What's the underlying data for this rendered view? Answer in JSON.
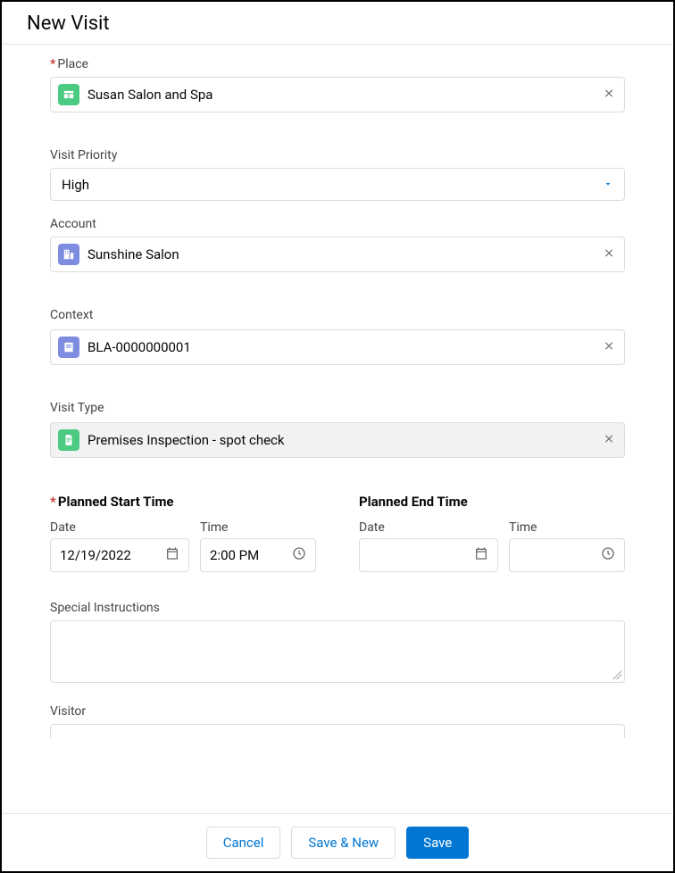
{
  "header": {
    "title": "New Visit"
  },
  "fields": {
    "place": {
      "label": "Place",
      "value": "Susan Salon and Spa",
      "required": true
    },
    "priority": {
      "label": "Visit Priority",
      "value": "High"
    },
    "account": {
      "label": "Account",
      "value": "Sunshine Salon"
    },
    "context": {
      "label": "Context",
      "value": "BLA-0000000001"
    },
    "visitType": {
      "label": "Visit Type",
      "value": "Premises Inspection - spot check"
    },
    "plannedStart": {
      "heading": "Planned Start Time",
      "required": true,
      "dateLabel": "Date",
      "dateValue": "12/19/2022",
      "timeLabel": "Time",
      "timeValue": "2:00 PM"
    },
    "plannedEnd": {
      "heading": "Planned End Time",
      "dateLabel": "Date",
      "dateValue": "",
      "timeLabel": "Time",
      "timeValue": ""
    },
    "specialInstructions": {
      "label": "Special Instructions",
      "value": ""
    },
    "visitor": {
      "label": "Visitor"
    }
  },
  "footer": {
    "cancel": "Cancel",
    "saveNew": "Save & New",
    "save": "Save"
  }
}
